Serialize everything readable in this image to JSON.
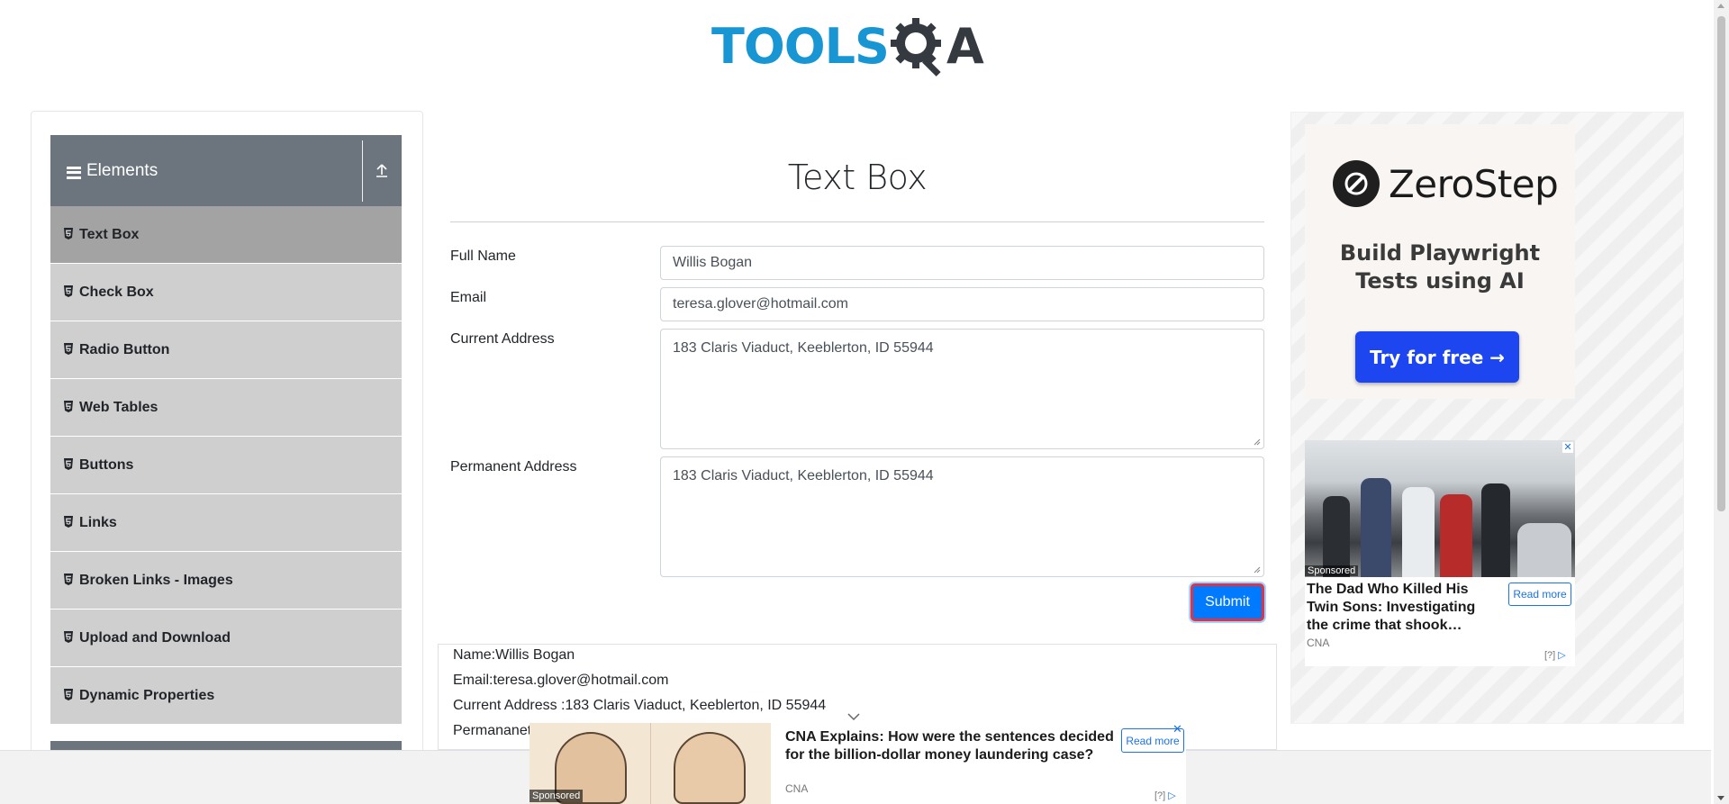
{
  "header": {
    "logo_text": "TOOLS",
    "logo_suffix": "A"
  },
  "sidebar": {
    "group_title": "Elements",
    "items": [
      {
        "label": "Text Box",
        "active": true
      },
      {
        "label": "Check Box",
        "active": false
      },
      {
        "label": "Radio Button",
        "active": false
      },
      {
        "label": "Web Tables",
        "active": false
      },
      {
        "label": "Buttons",
        "active": false
      },
      {
        "label": "Links",
        "active": false
      },
      {
        "label": "Broken Links - Images",
        "active": false
      },
      {
        "label": "Upload and Download",
        "active": false
      },
      {
        "label": "Dynamic Properties",
        "active": false
      }
    ]
  },
  "main": {
    "title": "Text Box",
    "fields": {
      "full_name": {
        "label": "Full Name",
        "value": "Willis Bogan"
      },
      "email": {
        "label": "Email",
        "value": "teresa.glover@hotmail.com"
      },
      "current_address": {
        "label": "Current Address",
        "value": "183 Claris Viaduct, Keeblerton, ID 55944"
      },
      "permanent_address": {
        "label": "Permanent Address",
        "value": "183 Claris Viaduct, Keeblerton, ID 55944"
      }
    },
    "submit_label": "Submit",
    "output": {
      "name": "Name:Willis Bogan",
      "email": "Email:teresa.glover@hotmail.com",
      "current_address": "Current Address :183 Claris Viaduct, Keeblerton, ID 55944",
      "permanent_address": "Permananet"
    }
  },
  "right_ad": {
    "brand": "ZeroStep",
    "tagline_line1": "Build Playwright",
    "tagline_line2": "Tests using AI",
    "cta": "Try for free →",
    "sponsored_card": {
      "sponsored_label": "Sponsored",
      "headline": "The Dad Who Killed His Twin Sons: Investigating the crime that shook…",
      "read_more": "Read more",
      "source": "CNA",
      "adchoice": "[?]"
    }
  },
  "bottom_ad": {
    "sponsored_label": "Sponsored",
    "headline": "CNA Explains: How were the sentences decided for the billion-dollar money laundering case?",
    "read_more": "Read more",
    "source": "CNA",
    "adchoice": "[?]",
    "close": "✕"
  },
  "colors": {
    "brand_blue": "#1896d4",
    "sidebar_header": "#6c757d",
    "menu_bg": "#cfcfcf",
    "menu_active": "#a3a3a3",
    "submit_bg": "#007bff",
    "submit_border": "#dc3545",
    "zerostep_cta": "#1d46f0"
  }
}
